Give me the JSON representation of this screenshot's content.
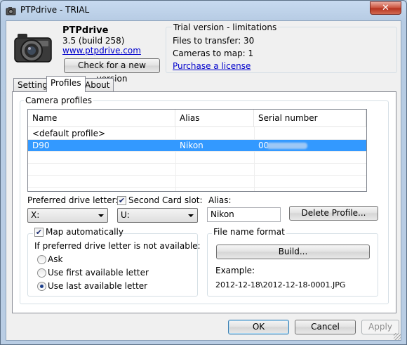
{
  "window": {
    "title": "PTPdrive - TRIAL",
    "close_glyph": "✕"
  },
  "product": {
    "name": "PTPdrive",
    "version": "3.5 (build 258)",
    "url": "www.ptpdrive.com",
    "check_label": "Check for a new version"
  },
  "trial": {
    "title": "Trial version - limitations",
    "files": "Files to transfer: 30",
    "cameras": "Cameras to map: 1",
    "purchase": "Purchase a license"
  },
  "tabs": {
    "settings": "Settings",
    "profiles": "Profiles",
    "about": "About"
  },
  "profiles": {
    "group_title": "Camera profiles",
    "columns": {
      "name": "Name",
      "alias": "Alias",
      "serial": "Serial number"
    },
    "rows": [
      {
        "name": "<default profile>",
        "alias": "",
        "serial": ""
      },
      {
        "name": "D90",
        "alias": "Nikon",
        "serial": "00"
      }
    ]
  },
  "drive": {
    "label": "Preferred drive letter:",
    "value": "X:"
  },
  "second_card": {
    "label": "Second Card slot:",
    "value": "U:",
    "checked": true
  },
  "alias": {
    "label": "Alias:",
    "value": "Nikon"
  },
  "delete_label": "Delete Profile...",
  "map": {
    "label": "Map automatically",
    "checked": true,
    "question": "If preferred drive letter is not available:",
    "options": [
      "Ask",
      "Use first available letter",
      "Use last available letter"
    ],
    "selected": 2
  },
  "file_format": {
    "title": "File name format",
    "build_label": "Build...",
    "example_label": "Example:",
    "example_value": "2012-12-18\\2012-12-18-0001.JPG"
  },
  "buttons": {
    "ok": "OK",
    "cancel": "Cancel",
    "apply": "Apply"
  },
  "colors": {
    "selection": "#3399ff",
    "link": "#0000cc"
  }
}
